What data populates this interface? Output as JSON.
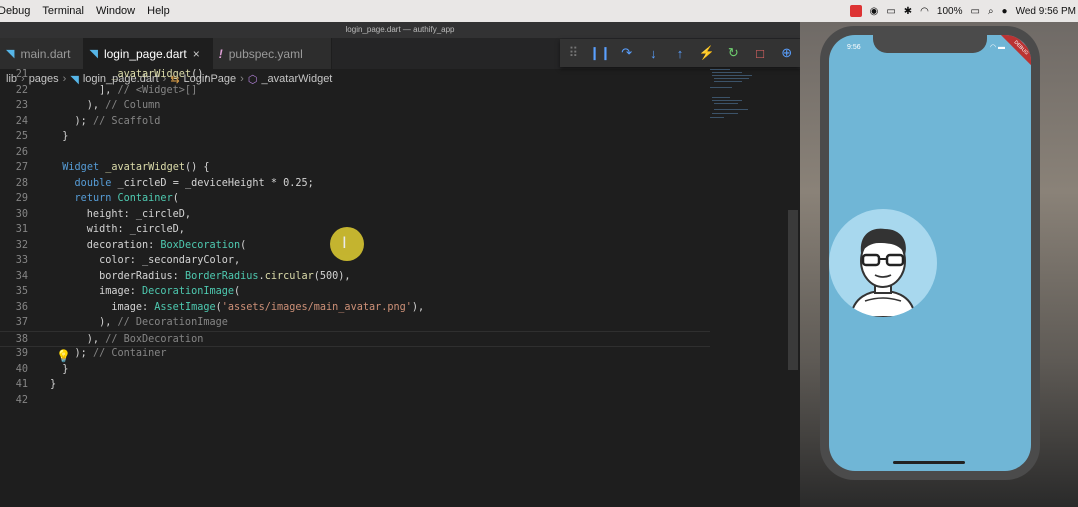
{
  "menubar": {
    "items": [
      "Debug",
      "Terminal",
      "Window",
      "Help"
    ],
    "battery": "100%",
    "clock": "Wed 9:56 PM"
  },
  "window": {
    "title": "login_page.dart — authify_app"
  },
  "tabs": [
    {
      "label": "main.dart",
      "icon": "dart-icon",
      "active": false
    },
    {
      "label": "login_page.dart",
      "icon": "dart-icon",
      "active": true,
      "close": "×"
    },
    {
      "label": "pubspec.yaml",
      "icon": "yaml-icon",
      "active": false
    }
  ],
  "debug_toolbar": [
    "grip-icon",
    "pause-icon",
    "step-over-icon",
    "step-into-icon",
    "step-out-icon",
    "hot-reload-icon",
    "restart-icon",
    "stop-icon",
    "devtools-icon"
  ],
  "breadcrumbs": [
    "lib",
    "pages",
    "login_page.dart",
    "LoginPage",
    "_avatarWidget"
  ],
  "code_lines": [
    {
      "n": "21",
      "text": "          _avatarWidget(),"
    },
    {
      "n": "22",
      "text": "        ], // <Widget>[]"
    },
    {
      "n": "23",
      "text": "      ), // Column"
    },
    {
      "n": "24",
      "text": "    ); // Scaffold"
    },
    {
      "n": "25",
      "text": "  }"
    },
    {
      "n": "26",
      "text": ""
    },
    {
      "n": "27",
      "text": "  Widget _avatarWidget() {"
    },
    {
      "n": "28",
      "text": "    double _circleD = _deviceHeight * 0.25;"
    },
    {
      "n": "29",
      "text": "    return Container("
    },
    {
      "n": "30",
      "text": "      height: _circleD,"
    },
    {
      "n": "31",
      "text": "      width: _circleD,"
    },
    {
      "n": "32",
      "text": "      decoration: BoxDecoration("
    },
    {
      "n": "33",
      "text": "        color: _secondaryColor,"
    },
    {
      "n": "34",
      "text": "        borderRadius: BorderRadius.circular(500),"
    },
    {
      "n": "35",
      "text": "        image: DecorationImage("
    },
    {
      "n": "36",
      "text": "          image: AssetImage('assets/images/main_avatar.png'),"
    },
    {
      "n": "37",
      "text": "        ), // DecorationImage"
    },
    {
      "n": "38",
      "text": "      ), // BoxDecoration"
    },
    {
      "n": "39",
      "text": "    ); // Container"
    },
    {
      "n": "40",
      "text": "  }"
    },
    {
      "n": "41",
      "text": "}"
    },
    {
      "n": "42",
      "text": ""
    }
  ],
  "phone": {
    "time": "9:56",
    "banner": "DEBUG"
  },
  "colors": {
    "phone_screen": "#70b6d6",
    "avatar_bg": "#a8d8ee"
  }
}
